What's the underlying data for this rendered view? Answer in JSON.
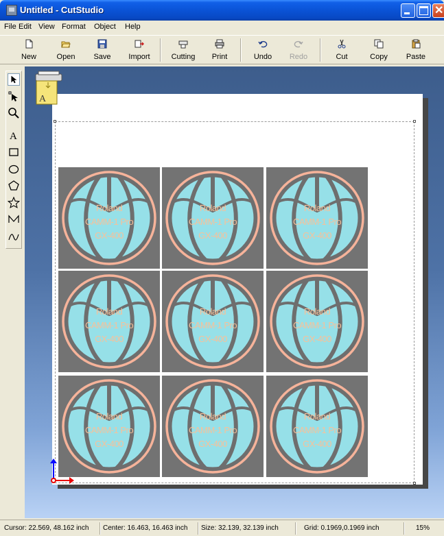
{
  "window": {
    "title": "Untitled - CutStudio"
  },
  "menu": [
    "File",
    "Edit",
    "View",
    "Format",
    "Object",
    "Help"
  ],
  "toolbar": {
    "new": "New",
    "open": "Open",
    "save": "Save",
    "import": "Import",
    "cutting": "Cutting",
    "print": "Print",
    "undo": "Undo",
    "redo": "Redo",
    "cut": "Cut",
    "copy": "Copy",
    "paste": "Paste"
  },
  "toolbox": [
    "select-arrow",
    "node-edit-arrow",
    "zoom",
    "text",
    "rectangle",
    "ellipse",
    "polygon",
    "star",
    "polyline",
    "curve"
  ],
  "canvas": {
    "tile_text": [
      "Roland",
      "CAMM-1 Pro",
      "GX-400"
    ],
    "tile_count": 9,
    "colors": {
      "tile": "#737373",
      "ball": "#96E0E8",
      "outline": "#F6B39A",
      "text": "#F6C19A",
      "canvas_top": "#3D5D8C",
      "canvas_bottom": "#B9D2F5"
    }
  },
  "status": {
    "cursor": "Cursor: 22.569, 48.162 inch",
    "center": "Center: 16.463, 16.463 inch",
    "size": "Size: 32.139, 32.139 inch",
    "grid": "Grid: 0.1969,0.1969 inch",
    "zoom": "15%"
  }
}
